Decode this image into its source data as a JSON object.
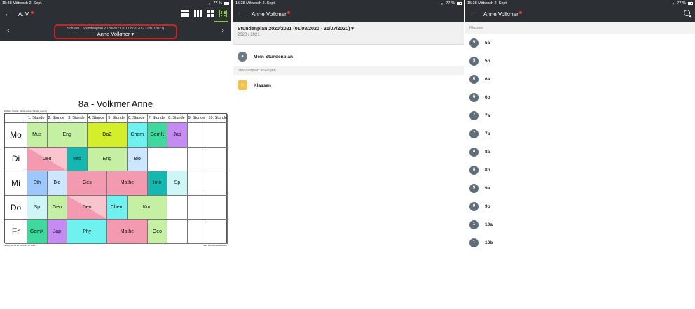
{
  "status": {
    "time": "15:38",
    "date": "Mittwoch 2. Sept.",
    "battery": "77 %"
  },
  "panel1": {
    "user": "A. V.",
    "subtitle": "Schüler · Stundenplan 2020/2021 (01/08/2020 - 31/07/2021)",
    "name": "Anne Volkmer",
    "timetable": {
      "title": "8a - Volkmer Anne",
      "school": "8 Rotes Schule, Martin-Luther-Straße, Leipzig",
      "periods": [
        "1. Stunde",
        "2. Stunde",
        "3. Stunde",
        "4. Stunde",
        "5. Stunde",
        "6. Stunde",
        "7. Stunde",
        "8. Stunde",
        "9. Stunde",
        "10. Stunde"
      ],
      "days": [
        "Mo",
        "Di",
        "Mi",
        "Do",
        "Fr"
      ],
      "lessons": [
        {
          "day": 0,
          "start": 0,
          "span": 1,
          "label": "Mus",
          "color": "#c5f0a4"
        },
        {
          "day": 0,
          "start": 1,
          "span": 2,
          "label": "Eng",
          "color": "#c5f0a4"
        },
        {
          "day": 0,
          "start": 3,
          "span": 2,
          "label": "DaZ",
          "color": "#d5ee2c"
        },
        {
          "day": 0,
          "start": 5,
          "span": 1,
          "label": "Chem",
          "color": "#6ff2ef"
        },
        {
          "day": 0,
          "start": 6,
          "span": 1,
          "label": "GemK",
          "color": "#3fd9a0"
        },
        {
          "day": 0,
          "start": 7,
          "span": 1,
          "label": "Jap",
          "color": "#c48cf3"
        },
        {
          "day": 1,
          "start": 0,
          "span": 2,
          "label": "Deu",
          "color": "#f39ab0",
          "split": "#f8c5cf"
        },
        {
          "day": 1,
          "start": 2,
          "span": 1,
          "label": "Info",
          "color": "#14b8b0"
        },
        {
          "day": 1,
          "start": 3,
          "span": 2,
          "label": "Eng",
          "color": "#c5f0a4"
        },
        {
          "day": 1,
          "start": 5,
          "span": 1,
          "label": "Bio",
          "color": "#cce6ff"
        },
        {
          "day": 2,
          "start": 0,
          "span": 1,
          "label": "Eth",
          "color": "#9cc8ff"
        },
        {
          "day": 2,
          "start": 1,
          "span": 1,
          "label": "Bio",
          "color": "#cce6ff"
        },
        {
          "day": 2,
          "start": 2,
          "span": 2,
          "label": "Ges",
          "color": "#f39ab0"
        },
        {
          "day": 2,
          "start": 4,
          "span": 2,
          "label": "Mathe",
          "color": "#f39ab0"
        },
        {
          "day": 2,
          "start": 6,
          "span": 1,
          "label": "Info",
          "color": "#14b8b0"
        },
        {
          "day": 2,
          "start": 7,
          "span": 1,
          "label": "Sp",
          "color": "#cff6f6"
        },
        {
          "day": 3,
          "start": 0,
          "span": 1,
          "label": "Sp",
          "color": "#cff6f6"
        },
        {
          "day": 3,
          "start": 1,
          "span": 1,
          "label": "Geo",
          "color": "#c5f0a4"
        },
        {
          "day": 3,
          "start": 2,
          "span": 2,
          "label": "Deu",
          "color": "#f39ab0",
          "split": "#f8c5cf"
        },
        {
          "day": 3,
          "start": 4,
          "span": 1,
          "label": "Chem",
          "color": "#6ff2ef"
        },
        {
          "day": 3,
          "start": 5,
          "span": 2,
          "label": "Kun",
          "color": "#c5f0a4"
        },
        {
          "day": 4,
          "start": 0,
          "span": 1,
          "label": "GemK",
          "color": "#3fd9a0"
        },
        {
          "day": 4,
          "start": 1,
          "span": 1,
          "label": "Jap",
          "color": "#c48cf3"
        },
        {
          "day": 4,
          "start": 2,
          "span": 2,
          "label": "Phy",
          "color": "#6ff2ef"
        },
        {
          "day": 4,
          "start": 4,
          "span": 2,
          "label": "Mathe",
          "color": "#f39ab0"
        },
        {
          "day": 4,
          "start": 6,
          "span": 1,
          "label": "Geo",
          "color": "#c5f0a4"
        }
      ],
      "footer_left": "Gültig ab: 01.08.2020-31.07.2021",
      "footer_right": "aSc Stundenpläne online"
    }
  },
  "panel2": {
    "title": "Anne Volkmer",
    "header_title": "Stundenplan 2020/2021 (01/08/2020 - 31/07/2021)",
    "header_sub": "2020 / 2021",
    "my_timetable": "Mein Stundenplan",
    "section": "Stundenplan anzeigen",
    "classes": "Klassen"
  },
  "panel3": {
    "title": "Anne Volkmer",
    "section": "Klassen",
    "classes": [
      {
        "num": "5",
        "name": "5a"
      },
      {
        "num": "5",
        "name": "5b"
      },
      {
        "num": "6",
        "name": "6a"
      },
      {
        "num": "6",
        "name": "6b"
      },
      {
        "num": "7",
        "name": "7a"
      },
      {
        "num": "7",
        "name": "7b"
      },
      {
        "num": "8",
        "name": "8a"
      },
      {
        "num": "8",
        "name": "8b"
      },
      {
        "num": "9",
        "name": "9a"
      },
      {
        "num": "9",
        "name": "9b"
      },
      {
        "num": "1",
        "name": "10a"
      },
      {
        "num": "1",
        "name": "10b"
      }
    ]
  }
}
